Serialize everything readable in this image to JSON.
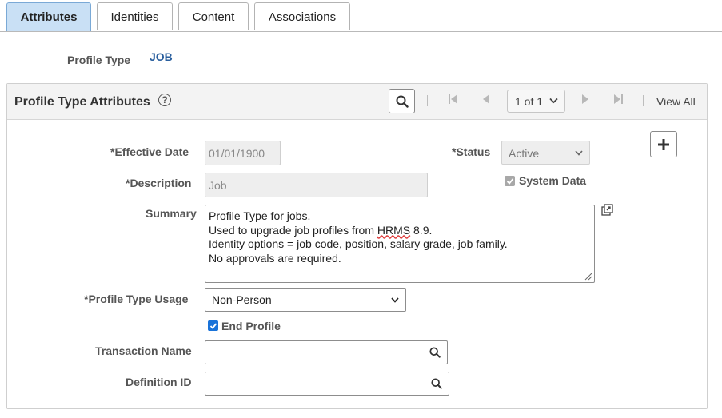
{
  "tabs": [
    {
      "label": "Attributes",
      "active": true
    },
    {
      "label": "Identities",
      "underline": "I",
      "rest": "dentities"
    },
    {
      "label": "Content",
      "underline": "C",
      "rest": "ontent"
    },
    {
      "label": "Associations",
      "underline": "A",
      "rest": "ssociations"
    }
  ],
  "header": {
    "profile_type_label": "Profile Type",
    "profile_type_value": "JOB"
  },
  "group": {
    "title": "Profile Type Attributes",
    "pager": "1 of 1",
    "view_all": "View All"
  },
  "form": {
    "effective_date_label": "*Effective Date",
    "effective_date_value": "01/01/1900",
    "status_label": "*Status",
    "status_value": "Active",
    "description_label": "*Description",
    "description_value": "Job",
    "system_data_label": "System Data",
    "summary_label": "Summary",
    "summary_lines": [
      "Profile Type for jobs.",
      "Used to upgrade job profiles from HRMS 8.9.",
      "Identity options = job code, position, salary grade, job family.",
      "No approvals are required."
    ],
    "usage_label": "*Profile Type Usage",
    "usage_value": "Non-Person",
    "end_profile_label": "End Profile",
    "transaction_name_label": "Transaction Name",
    "definition_id_label": "Definition ID"
  },
  "colors": {
    "active_tab": "#c9e0f5",
    "link": "#2a5f9e",
    "checkbox": "#1a73d9"
  }
}
